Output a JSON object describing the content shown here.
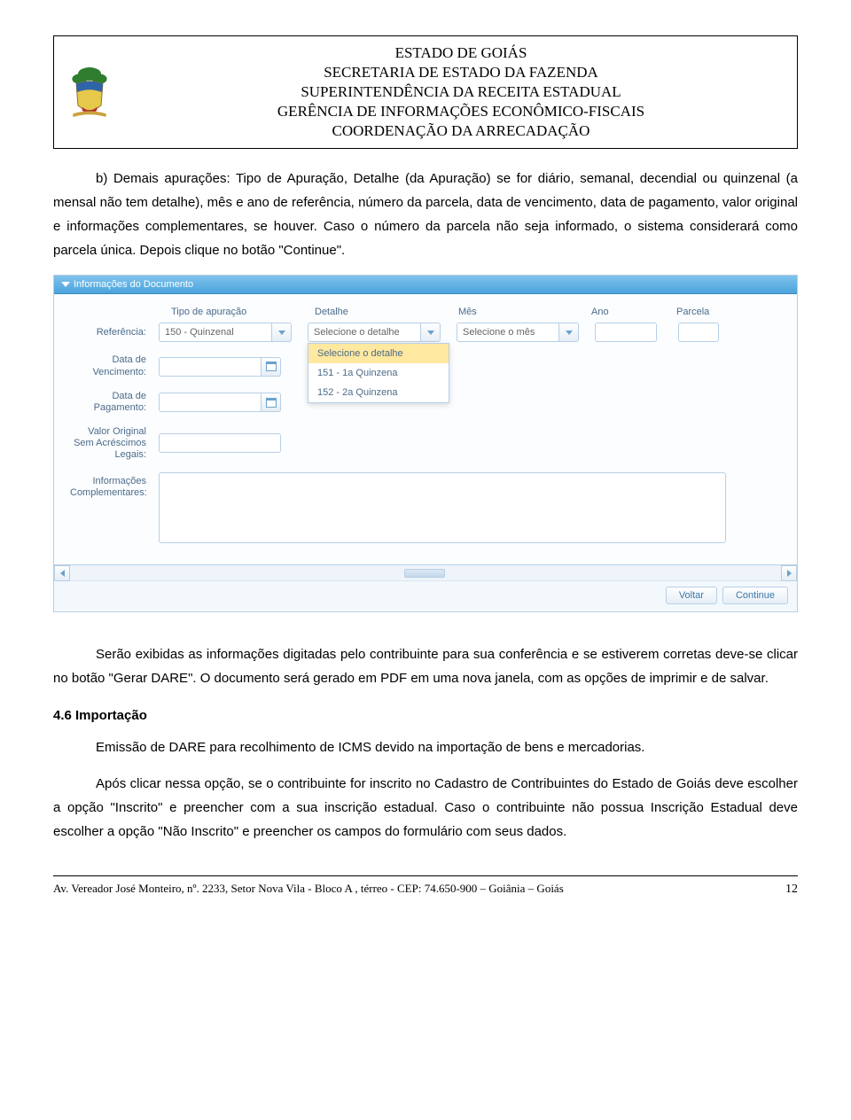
{
  "header": {
    "l1": "ESTADO DE GOIÁS",
    "l2": "SECRETARIA DE ESTADO DA FAZENDA",
    "l3": "SUPERINTENDÊNCIA DA RECEITA ESTADUAL",
    "l4": "GERÊNCIA DE INFORMAÇÕES ECONÔMICO-FISCAIS",
    "l5": "COORDENAÇÃO DA ARRECADAÇÃO"
  },
  "para1": "b) Demais apurações: Tipo de Apuração, Detalhe (da Apuração) se for diário, semanal, decendial ou quinzenal (a mensal não tem detalhe), mês e ano de referência, número da parcela, data de vencimento, data de pagamento, valor original e informações complementares, se houver.  Caso o número da parcela não seja informado, o sistema considerará como parcela única. Depois clique no botão \"Continue\".",
  "ui": {
    "panel_title": "Informações do Documento",
    "cols": {
      "tipo": "Tipo de apuração",
      "detalhe": "Detalhe",
      "mes": "Mês",
      "ano": "Ano",
      "parcela": "Parcela"
    },
    "labels": {
      "referencia": "Referência:",
      "data_venc": "Data de Vencimento:",
      "data_pag": "Data de Pagamento:",
      "valor": "Valor Original Sem Acréscimos Legais:",
      "info": "Informações Complementares:"
    },
    "tipo_value": "150 - Quinzenal",
    "detalhe_placeholder": "Selecione o detalhe",
    "mes_placeholder": "Selecione o mês",
    "dropdown_items": [
      "Selecione o detalhe",
      "151 - 1a Quinzena",
      "152 - 2a Quinzena"
    ],
    "buttons": {
      "voltar": "Voltar",
      "continue": "Continue"
    }
  },
  "para2": "Serão exibidas as informações digitadas pelo contribuinte para sua conferência e se estiverem corretas deve-se clicar no botão \"Gerar DARE\". O documento será gerado em PDF em uma nova janela, com as opções de imprimir e de salvar.",
  "section_title": "4.6 Importação",
  "para3": "Emissão de DARE para recolhimento de ICMS devido na importação de bens e mercadorias.",
  "para4": "Após clicar nessa opção, se o contribuinte for inscrito no Cadastro de Contribuintes do Estado de Goiás deve escolher a opção \"Inscrito\" e preencher com a sua inscrição estadual. Caso o contribuinte não possua Inscrição Estadual deve escolher a opção \"Não Inscrito\" e preencher os campos do formulário com seus dados.",
  "footer": {
    "address": "Av. Vereador José Monteiro, nº. 2233, Setor Nova Vila - Bloco A , térreo - CEP: 74.650-900 – Goiânia – Goiás",
    "page": "12"
  }
}
